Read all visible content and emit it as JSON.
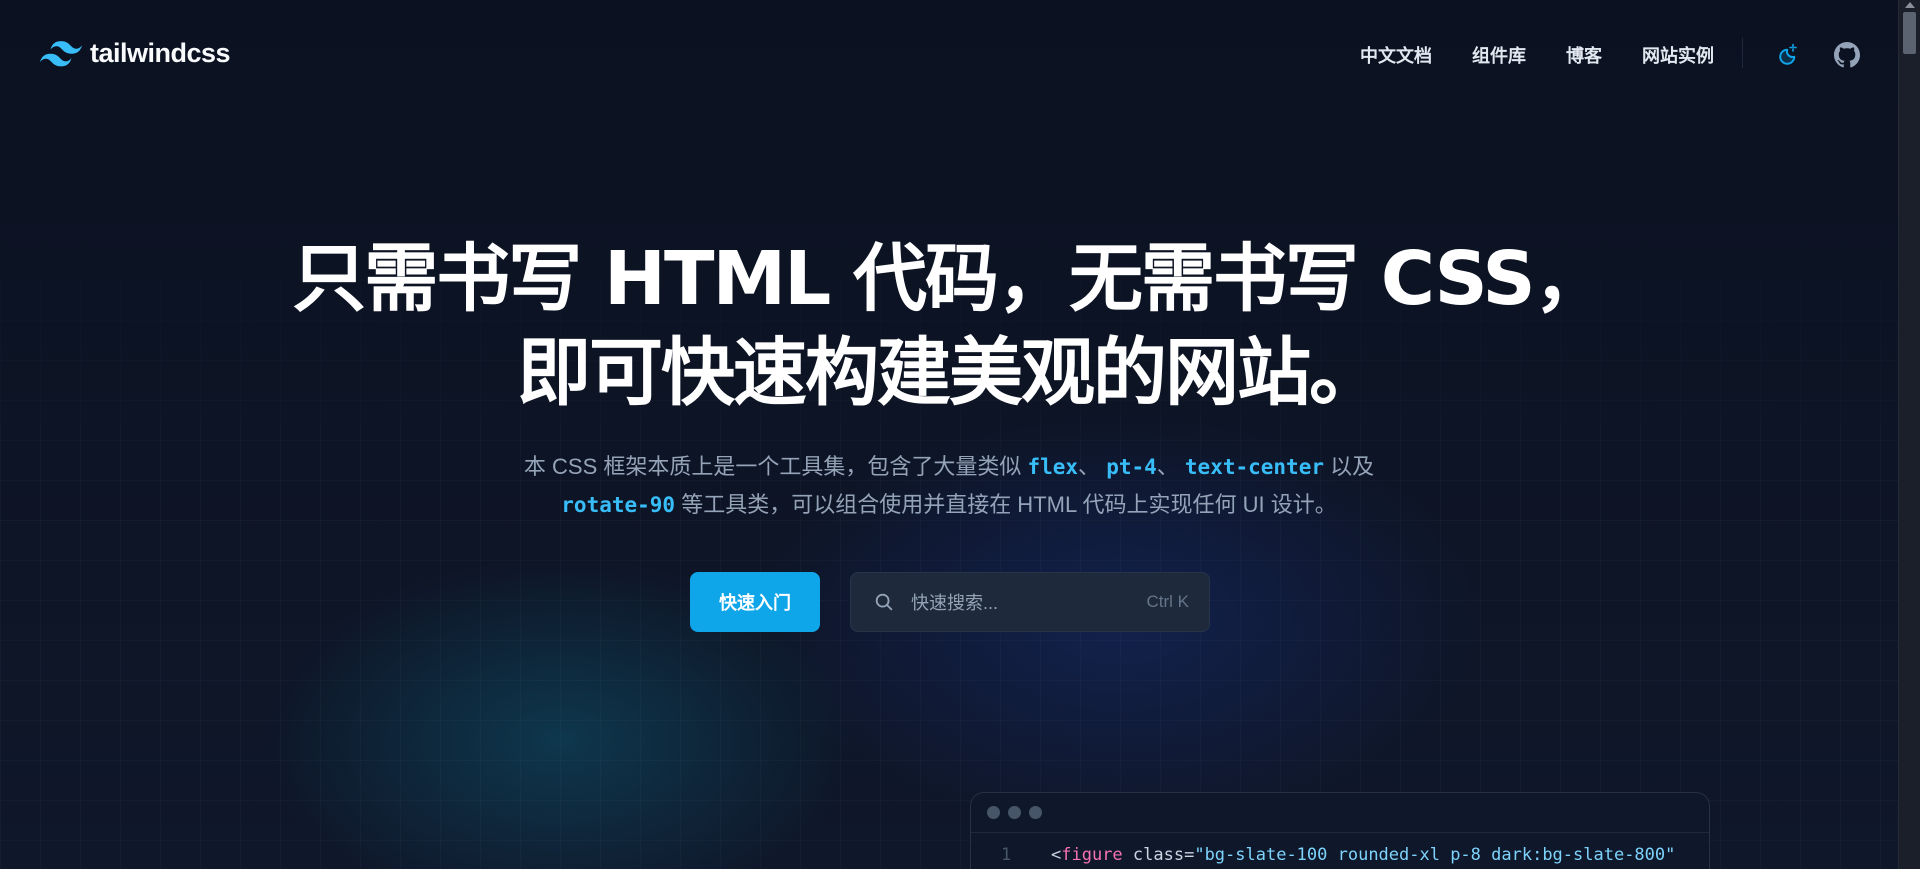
{
  "header": {
    "logo_text": "tailwindcss",
    "nav": [
      {
        "label": "中文文档"
      },
      {
        "label": "组件库"
      },
      {
        "label": "博客"
      },
      {
        "label": "网站实例"
      }
    ]
  },
  "hero": {
    "title_line1": "只需书写 HTML 代码，无需书写 CSS，",
    "title_line2": "即可快速构建美观的网站。",
    "sub_part1": "本 CSS 框架本质上是一个工具集，包含了大量类似 ",
    "code1": "flex",
    "sep1": "、",
    "code2": "pt-4",
    "sep2": "、",
    "code3": "text-center",
    "sub_part2": " 以及",
    "code4": "rotate-90",
    "sub_part3": " 等工具类，可以组合使用并直接在 HTML 代码上实现任何 UI 设计。"
  },
  "cta": {
    "label": "快速入门"
  },
  "search": {
    "placeholder": "快速搜索...",
    "shortcut": "Ctrl K"
  },
  "code_window": {
    "line_number": "1",
    "tag_open": "<",
    "tag_name": "figure",
    "attr_name": " class=",
    "attr_value": "\"bg-slate-100 rounded-xl p-8 dark:bg-slate-800\""
  },
  "colors": {
    "accent": "#0ea5e9",
    "code_highlight": "#38bdf8",
    "background": "#0f172a"
  },
  "icons": {
    "logo": "tailwind-wave-icon",
    "theme": "moon-sparkle-icon",
    "github": "github-icon",
    "search": "search-icon"
  }
}
